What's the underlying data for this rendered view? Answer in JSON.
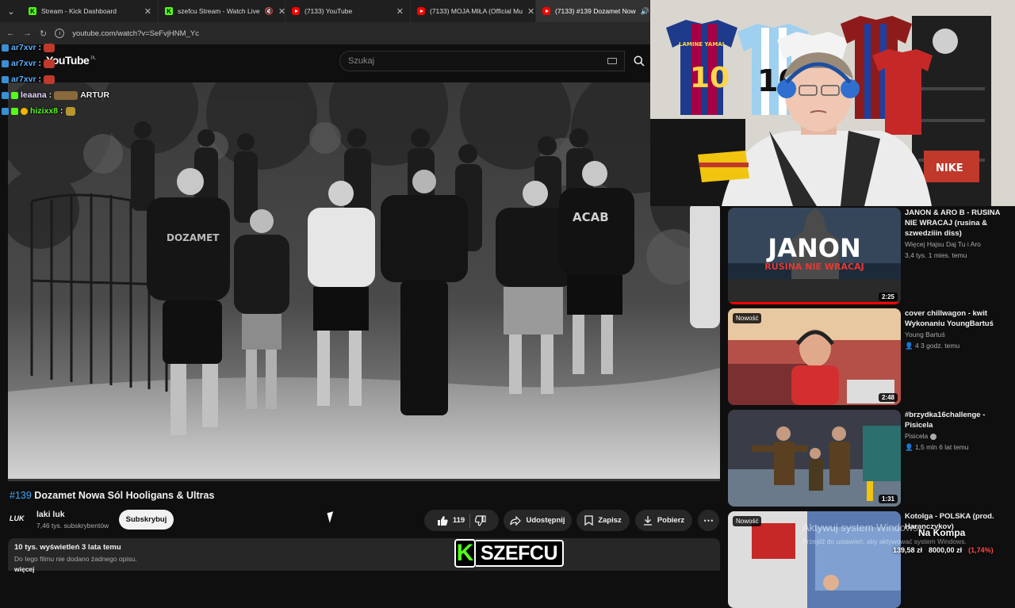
{
  "browser": {
    "tabs": [
      {
        "label": "Stream - Kick Dashboard",
        "icon": "kick"
      },
      {
        "label": "szefcu Stream - Watch Live",
        "icon": "kick"
      },
      {
        "label": "(7133) YouTube",
        "icon": "youtube"
      },
      {
        "label": "(7133) MOJA MIŁA (Official Mu",
        "icon": "youtube"
      },
      {
        "label": "(7133) #139 Dozamet Now",
        "icon": "youtube"
      }
    ],
    "url": "youtube.com/watch?v=SeFvjHNM_Yc"
  },
  "youtube": {
    "logo": "YouTube",
    "region": "PL",
    "search_placeholder": "Szukaj"
  },
  "chat": [
    {
      "user": "ar7xvr",
      "sep": ":",
      "msg": "",
      "color": "#5ab0ff"
    },
    {
      "user": "ar7xvr",
      "sep": ":",
      "msg": "",
      "color": "#5ab0ff"
    },
    {
      "user": "ar7xvr",
      "sep": ":",
      "msg": "",
      "color": "#5ab0ff"
    },
    {
      "user": "leaana",
      "sep": ":",
      "msg": "ARTUR",
      "color": "#e8d9ff"
    },
    {
      "user": "hizixx8",
      "sep": ":",
      "msg": "",
      "color": "#53fc18"
    }
  ],
  "video": {
    "hash": "#139",
    "title": "Dozamet Nowa Sól Hooligans & Ultras",
    "shirt_text_1": "DOZAMET",
    "shirt_text_2": "ACAB",
    "channel": {
      "name": "laki luk",
      "subs": "7,46 tys. subskrybentów",
      "avatar_text": "LUK"
    },
    "subscribe_label": "Subskrybuj",
    "likes": "119",
    "share_label": "Udostępnij",
    "save_label": "Zapisz",
    "download_label": "Pobierz",
    "more_label": "⋯",
    "views": "10 tys. wyświetleń  3 lata temu",
    "description": "Do tego filmu nie dodano żadnego opisu.",
    "desc_more": "więcej"
  },
  "recommendations": [
    {
      "title": "JANON & ARO B - RUSINA NIE WRACAJ (rusina & szwedziiin diss)",
      "channel": "Więcej Hajsu Daj Tu i Aro",
      "meta": "3,4 tys.  1 mies. temu",
      "duration": "2:25",
      "thumb_title": "JANON",
      "thumb_subtitle": "RUSINA NIE WRACAJ",
      "new": ""
    },
    {
      "title": "cover chillwagon - kwit Wykonaniu YoungBartuś",
      "channel": "Young Bartuś",
      "meta": "4  3 godz. temu",
      "duration": "2:48",
      "new": "Nowość"
    },
    {
      "title": "#brzydka16challenge - Pisicela",
      "channel": "Pisicela",
      "meta": "1,5 mln  6 lat temu",
      "duration": "1:31",
      "new": ""
    },
    {
      "title": "Kotolga - POLSKA (prod. Haranczykov)",
      "channel": "",
      "meta": "",
      "duration": "",
      "new": "Nowość"
    }
  ],
  "overlay": {
    "kick_k": "K",
    "kick_name": "SZEFCU",
    "na_kompa": "Na Kompa",
    "balance_1": "139,58 zł",
    "balance_2": "8000,00 zł",
    "balance_3": "(1,74%)",
    "activate_title": "Aktywuj system Windows",
    "activate_text": "Przejdź do ustawień, aby aktywować system Windows."
  },
  "webcam": {
    "jersey_1_name": "LAMINE YAMAL",
    "jersey_1_number": "10",
    "jersey_2_number": "10",
    "sneaker_box": "NIKE"
  },
  "colors": {
    "kick_green": "#53fc18",
    "yt_red": "#ff0000",
    "link_blue": "#3ea6ff"
  }
}
